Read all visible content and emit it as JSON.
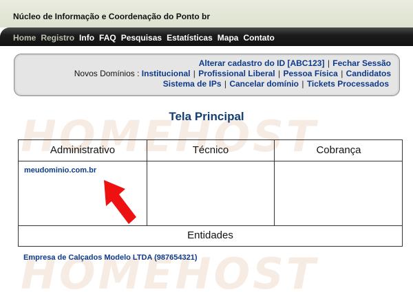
{
  "header": {
    "site_title": "Núcleo de Informação e Coordenação do Ponto br"
  },
  "nav": {
    "items": [
      {
        "label": "Home",
        "dim": true
      },
      {
        "label": "Registro",
        "dim": true
      },
      {
        "label": "Info",
        "dim": false
      },
      {
        "label": "FAQ",
        "dim": false
      },
      {
        "label": "Pesquisas",
        "dim": false
      },
      {
        "label": "Estatísticas",
        "dim": false
      },
      {
        "label": "Mapa",
        "dim": false
      },
      {
        "label": "Contato",
        "dim": false
      }
    ]
  },
  "panel": {
    "alterar_cadastro": "Alterar cadastro do ID [ABC123]",
    "fechar_sessao": "Fechar Sessão",
    "novos_dominios_label": "Novos Domínios :",
    "institucional": "Institucional",
    "profissional_liberal": "Profissional Liberal",
    "pessoa_fisica": "Pessoa Física",
    "candidatos": "Candidatos",
    "sistema_ips": "Sistema de IPs",
    "cancelar_dominio": "Cancelar domínio",
    "tickets_processados": "Tickets Processados",
    "separator": "|"
  },
  "watermark": "HOMEHOST",
  "main": {
    "title": "Tela Principal",
    "columns": [
      "Administrativo",
      "Técnico",
      "Cobrança"
    ],
    "admin_domain": "meudominio.com.br",
    "entities_header": "Entidades",
    "company": "Empresa de Calçados Modelo LTDA (987654321)"
  },
  "colors": {
    "link": "#0e3a8a",
    "title": "#123e73",
    "arrow": "#ee1111",
    "navbar": "#1c1c1c"
  },
  "icons": {
    "pointer": "red-arrow-icon"
  }
}
